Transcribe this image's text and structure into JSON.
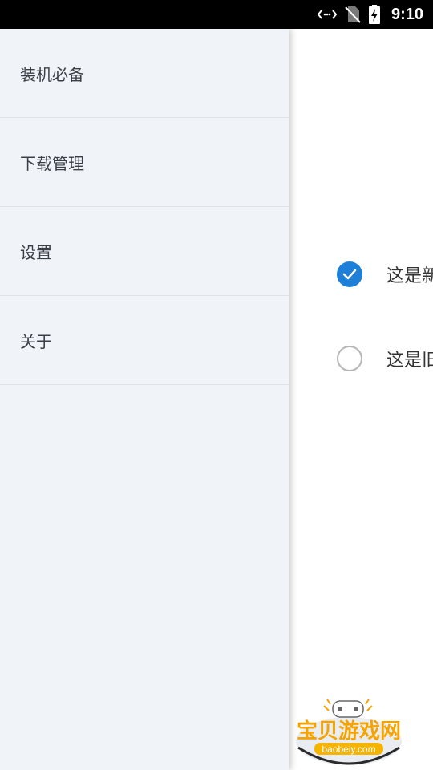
{
  "status_bar": {
    "time": "9:10",
    "icons": [
      "data-sync-icon",
      "no-sim-icon",
      "battery-charging-icon"
    ]
  },
  "drawer": {
    "items": [
      {
        "label": "装机必备"
      },
      {
        "label": "下载管理"
      },
      {
        "label": "设置"
      },
      {
        "label": "关于"
      }
    ]
  },
  "main": {
    "options": [
      {
        "label": "这是新",
        "checked": true
      },
      {
        "label": "这是旧",
        "checked": false
      }
    ]
  },
  "watermark": {
    "title": "宝贝游戏网",
    "url": "baobeiy.com",
    "colors": {
      "title": "#f5a300",
      "url_bg": "#f5b400"
    }
  },
  "colors": {
    "accent": "#1e7fd9",
    "drawer_bg": "#f0f4f8"
  }
}
